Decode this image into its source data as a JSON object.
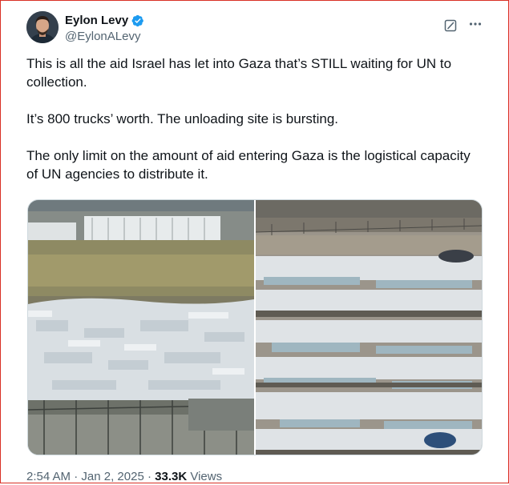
{
  "author": {
    "name": "Eylon Levy",
    "handle": "@EylonALevy",
    "verified": true,
    "accent": "#1d9bf0"
  },
  "tweet": {
    "paragraphs": [
      "This is all the aid Israel has let into Gaza that’s STILL waiting for UN to collection.",
      "It’s 800 trucks’ worth. The unloading site is bursting.",
      "The only limit on the amount of aid entering Gaza is the logistical capacity of UN agencies to distribute it."
    ]
  },
  "meta": {
    "time": "2:54 AM",
    "separator": " · ",
    "date": "Jan 2, 2025",
    "views_count": "33.3K",
    "views_label": "Views"
  },
  "icons": {
    "verified": "verified-badge-icon",
    "grok": "grok-icon",
    "more": "more-icon"
  }
}
